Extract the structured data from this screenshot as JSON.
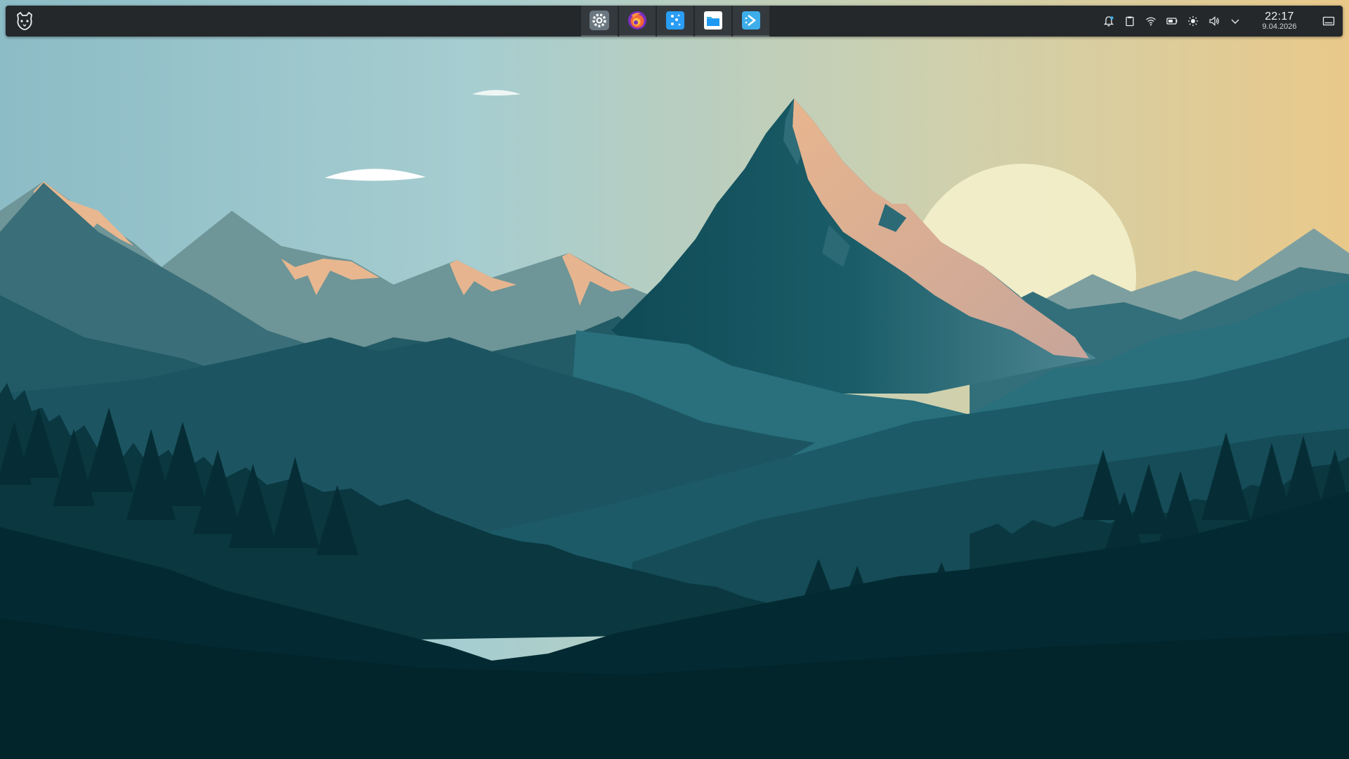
{
  "desktop": {
    "wallpaper": "mountain-landscape-wallpaper",
    "colors": {
      "sky_left": "#8fbfc9",
      "sky_right": "#e9c98b",
      "sun": "#f2efc8",
      "peak_highlight": "#e8b68f",
      "forest_dark": "#03262e",
      "panel_bg": "#24282b"
    }
  },
  "panel": {
    "launcher": {
      "icon": "kde-launcher-icon"
    },
    "taskbar": [
      {
        "icon": "system-settings-icon",
        "accent": "#6b7780"
      },
      {
        "icon": "firefox-icon",
        "accent": "#8c2ec8"
      },
      {
        "icon": "discover-icon",
        "accent": "#2a9df4"
      },
      {
        "icon": "dolphin-folder-icon",
        "accent": "#3daee9"
      },
      {
        "icon": "remote-desktop-icon",
        "accent": "#3daee9"
      }
    ],
    "tray": {
      "icons": [
        "notifications-icon",
        "clipboard-icon",
        "wifi-icon",
        "battery-icon",
        "brightness-icon",
        "volume-icon",
        "chevron-down-icon"
      ],
      "clock": {
        "time": "22:17",
        "date": "9.04.2026"
      },
      "show_desktop": "show-desktop-icon"
    }
  }
}
